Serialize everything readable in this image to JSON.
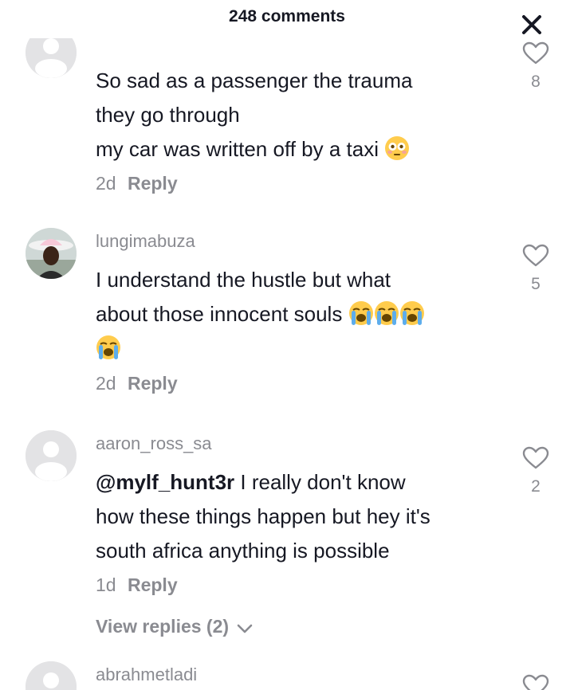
{
  "header": {
    "title": "248 comments"
  },
  "comments": [
    {
      "username": "",
      "lines": [
        "So sad as a passenger the trauma",
        "they go through",
        "my car was written off by a taxi"
      ],
      "time": "2d",
      "reply_label": "Reply",
      "likes": "8"
    },
    {
      "username": "lungimabuza",
      "lines": [
        "I understand the hustle but what",
        "about those innocent souls"
      ],
      "time": "2d",
      "reply_label": "Reply",
      "likes": "5"
    },
    {
      "username": "aaron_ross_sa",
      "mention": "@mylf_hunt3r",
      "lines": [
        " I really don't know",
        "how these things happen but hey it's",
        "south africa anything is possible"
      ],
      "time": "1d",
      "reply_label": "Reply",
      "likes": "2",
      "view_replies": "View replies (2)"
    },
    {
      "username": "abrahmetladi"
    }
  ],
  "icons": {
    "close": "close-icon",
    "like": "heart-outline-icon",
    "flushed_emoji": "flushed-face-emoji",
    "crying_emoji": "loudly-crying-face-emoji"
  }
}
